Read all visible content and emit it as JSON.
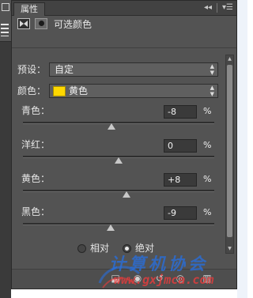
{
  "window": {
    "tab_label": "属性",
    "collapse_icon": "double-chevron-left-icon",
    "menu_icon": "panel-menu-icon"
  },
  "header": {
    "adjustment_icon": "selective-color-icon",
    "mask_icon": "layer-mask-icon",
    "title": "可选颜色"
  },
  "preset": {
    "label": "预设：",
    "value": "自定"
  },
  "colors": {
    "label": "颜色：",
    "value": "黄色",
    "swatch_color": "#ffd800"
  },
  "sliders": [
    {
      "label": "青色：",
      "value": "-8",
      "unit": "%",
      "level": -8
    },
    {
      "label": "洋红：",
      "value": "0",
      "unit": "%",
      "level": 0
    },
    {
      "label": "黄色：",
      "value": "+8",
      "unit": "%",
      "level": 8
    },
    {
      "label": "黑色：",
      "value": "-9",
      "unit": "%",
      "level": -9
    }
  ],
  "method": {
    "relative_label": "相对",
    "absolute_label": "绝对",
    "selected": "absolute"
  },
  "footer": {
    "icons": [
      "clip-to-layer-icon",
      "view-previous-icon",
      "reset-icon",
      "visibility-eye-icon",
      "trash-icon"
    ]
  },
  "watermark": {
    "title": "计算机协会",
    "url": "www.gxjmca.com"
  },
  "theme": {
    "panel_bg": "#535353",
    "accent_yellow": "#ffd800",
    "watermark_blue": "#286edc",
    "watermark_red": "#e63c3c"
  }
}
